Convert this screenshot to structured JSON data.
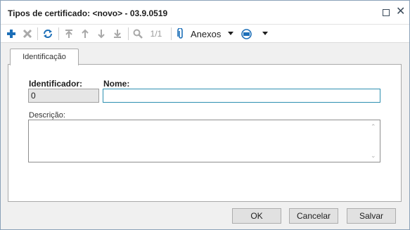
{
  "window": {
    "title": "Tipos de certificado: <novo> - 03.9.0519"
  },
  "toolbar": {
    "items": [
      {
        "icon": "plus-icon",
        "enabled": true
      },
      {
        "icon": "delete-icon",
        "enabled": false
      },
      {
        "icon": "refresh-icon",
        "enabled": true
      },
      {
        "icon": "first-record-icon",
        "enabled": false
      },
      {
        "icon": "previous-record-icon",
        "enabled": false
      },
      {
        "icon": "next-record-icon",
        "enabled": false
      },
      {
        "icon": "last-record-icon",
        "enabled": false
      },
      {
        "icon": "search-icon",
        "enabled": false
      }
    ],
    "record_counter": "1/1",
    "attachments_label": "Anexos",
    "accent_color": "#1d6fb8"
  },
  "tabs": [
    {
      "label": "Identificação",
      "active": true
    }
  ],
  "form": {
    "identifier_label": "Identificador:",
    "identifier_value": "0",
    "name_label": "Nome:",
    "name_value": "",
    "description_label": "Descrição:",
    "description_value": ""
  },
  "footer": {
    "ok_label": "OK",
    "cancel_label": "Cancelar",
    "save_label": "Salvar"
  }
}
